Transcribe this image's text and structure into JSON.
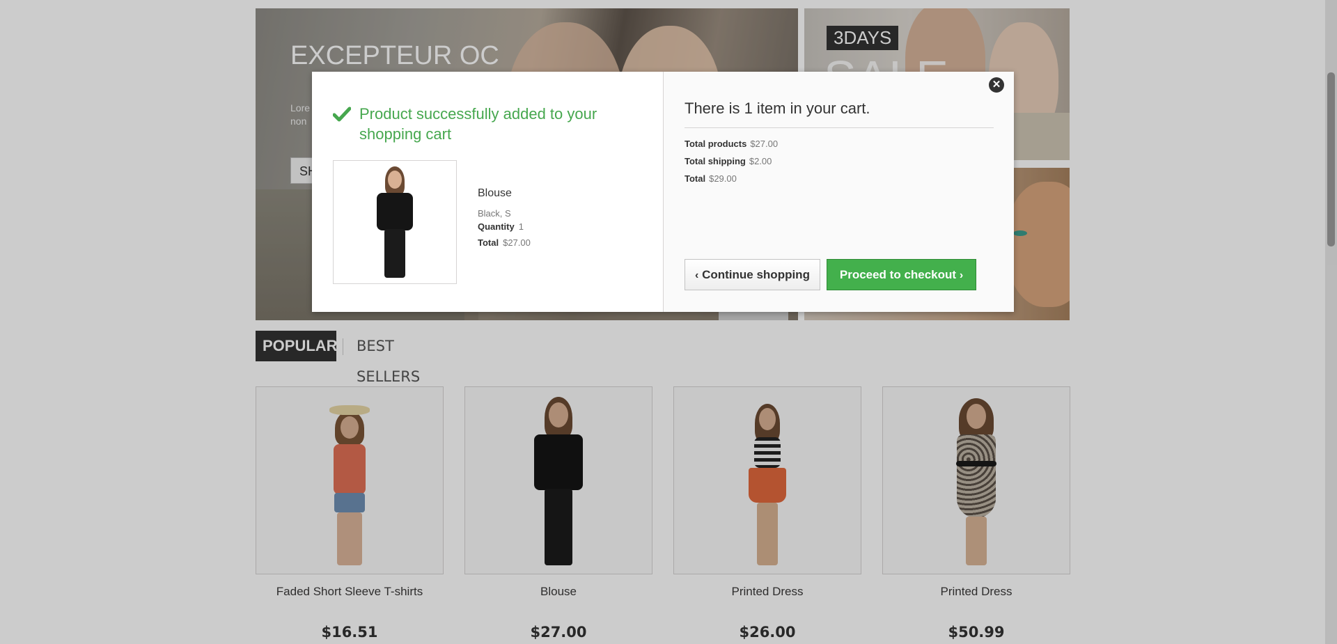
{
  "banner": {
    "title": "EXCEPTEUR OC",
    "text": "Lore elit. non",
    "button": "SH"
  },
  "promos": {
    "badge": "3DAYS",
    "sale": "SALE"
  },
  "tabs": [
    {
      "label": "POPULAR"
    },
    {
      "label": "BEST SELLERS"
    }
  ],
  "products": [
    {
      "name": "Faded Short Sleeve T-shirts",
      "price": "$16.51"
    },
    {
      "name": "Blouse",
      "price": "$27.00"
    },
    {
      "name": "Printed Dress",
      "price": "$26.00"
    },
    {
      "name": "Printed Dress",
      "price": "$50.99"
    }
  ],
  "modal": {
    "success_message": "Product successfully added to your shopping cart",
    "product": {
      "name": "Blouse",
      "attributes": "Black, S",
      "quantity_label": "Quantity",
      "quantity": "1",
      "total_label": "Total",
      "total": "$27.00"
    },
    "cart": {
      "title": "There is 1 item in your cart.",
      "total_products_label": "Total products",
      "total_products": "$27.00",
      "total_shipping_label": "Total shipping",
      "total_shipping": "$2.00",
      "total_label": "Total",
      "total": "$29.00"
    },
    "continue_label": "Continue shopping",
    "checkout_label": "Proceed to checkout",
    "close_symbol": "✕"
  },
  "colors": {
    "success_green": "#46a74e",
    "checkout_button": "#43b04c",
    "dark_tab": "#333333"
  },
  "icons": [
    "check-icon",
    "close-icon",
    "chevron-left-icon",
    "chevron-right-icon"
  ]
}
